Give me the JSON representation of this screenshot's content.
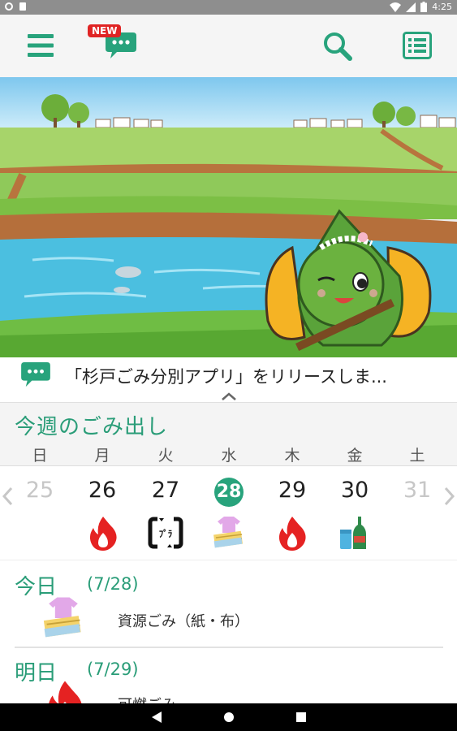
{
  "status_bar": {
    "time": "4:25"
  },
  "header": {
    "new_badge": "NEW"
  },
  "news": {
    "text": "「杉戸ごみ分別アプリ」をリリースしま..."
  },
  "week": {
    "title": "今週のごみ出し",
    "days": [
      {
        "dow": "日",
        "date": "25",
        "icon": "none",
        "muted": true
      },
      {
        "dow": "月",
        "date": "26",
        "icon": "burnable-fire-icon"
      },
      {
        "dow": "火",
        "date": "27",
        "icon": "plastic-recycle-icon"
      },
      {
        "dow": "水",
        "date": "28",
        "icon": "paper-cloth-icon",
        "today": true
      },
      {
        "dow": "木",
        "date": "29",
        "icon": "burnable-fire-icon"
      },
      {
        "dow": "金",
        "date": "30",
        "icon": "bottles-cans-icon"
      },
      {
        "dow": "土",
        "date": "31",
        "icon": "none",
        "muted": true
      }
    ]
  },
  "schedule": [
    {
      "day": "今日",
      "date": "(7/28)",
      "type": "資源ごみ（紙・布）",
      "icon": "paper-cloth-icon"
    },
    {
      "day": "明日",
      "date": "(7/29)",
      "type": "可燃ごみ",
      "icon": "burnable-fire-icon"
    }
  ],
  "colors": {
    "accent": "#2a9d78",
    "today_circle": "#28a37c",
    "fire": "#e52222",
    "new_badge": "#e02424"
  }
}
